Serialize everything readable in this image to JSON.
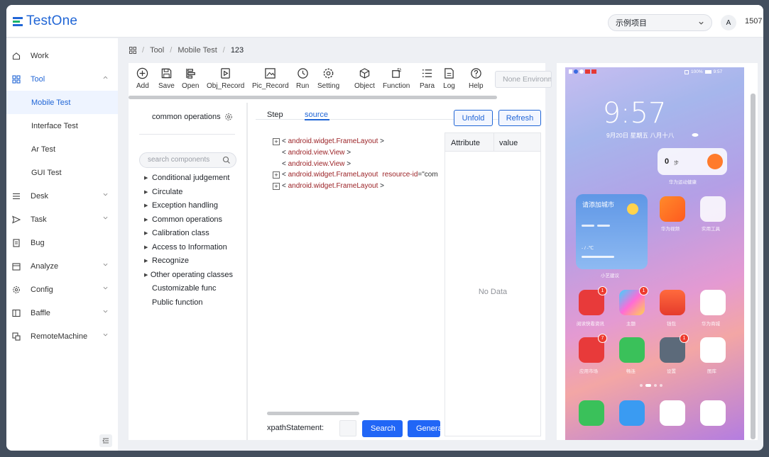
{
  "app": {
    "title": "TestOne"
  },
  "header": {
    "project": "示例项目",
    "translate_glyph": "A",
    "user": "1507"
  },
  "sidebar": {
    "items": [
      {
        "label": "Work",
        "icon": "home-icon"
      },
      {
        "label": "Tool",
        "icon": "grid-icon"
      },
      {
        "label": "Desk",
        "icon": "list-icon"
      },
      {
        "label": "Task",
        "icon": "send-icon"
      },
      {
        "label": "Bug",
        "icon": "document-icon"
      },
      {
        "label": "Analyze",
        "icon": "calendar-icon"
      },
      {
        "label": "Config",
        "icon": "gear-icon"
      },
      {
        "label": "Baffle",
        "icon": "panel-icon"
      },
      {
        "label": "RemoteMachine",
        "icon": "remote-icon"
      }
    ],
    "tool_subitems": [
      "Mobile Test",
      "Interface Test",
      "Ar Test",
      "GUI Test"
    ]
  },
  "breadcrumb": [
    "Tool",
    "Mobile Test",
    "123"
  ],
  "toolbar": {
    "buttons": [
      "Add",
      "Save",
      "Open",
      "Obj_Record",
      "Pic_Record",
      "Run",
      "Setting",
      "Object",
      "Function",
      "Para",
      "Log",
      "Help"
    ],
    "env_placeholder": "None Environment"
  },
  "components": {
    "header": "common operations",
    "search_placeholder": "search components",
    "groups": [
      "Conditional judgement",
      "Circulate",
      "Exception handling",
      "Common operations",
      "Calibration class",
      "Access to Information",
      "Recognize",
      "Other operating classes"
    ],
    "leaves": [
      "Customizable func",
      "Public function"
    ]
  },
  "source": {
    "tabs": [
      "Step",
      "source"
    ],
    "unfold": "Unfold",
    "refresh": "Refresh",
    "tree": [
      {
        "text": "android.widget.FrameLayout",
        "expandable": true
      },
      {
        "text": "android.view.View",
        "expandable": false
      },
      {
        "text": "android.view.View",
        "expandable": false
      },
      {
        "text": "android.widget.FrameLayout",
        "expandable": true,
        "attr": "resource-id",
        "attr_value": "=\"com"
      },
      {
        "text": "android.widget.FrameLayout",
        "expandable": true
      }
    ],
    "open_bracket": "<",
    "close_bracket": ">",
    "attr_header": "Attribute",
    "value_header": "value",
    "no_data": "No Data",
    "xpath_label": "xpathStatement:",
    "search_btn": "Search",
    "generate_btn": "Generate"
  },
  "phone": {
    "time": "9:57",
    "status_time": "9:57",
    "battery": "100%",
    "date": "9月20日 星期五 八月十八",
    "steps": "0",
    "steps_unit": "步",
    "health_label": "华为运动健康",
    "weather_title": "请添加城市",
    "weather_temp": "- / -℃",
    "weather_label": "小艺建议",
    "apps_row1": [
      {
        "label": "华为视频"
      },
      {
        "label": "实用工具"
      }
    ],
    "apps_row2": [
      {
        "label": "阅读快看资讯",
        "badge": "1"
      },
      {
        "label": "主题",
        "badge": "1"
      },
      {
        "label": "钱包",
        "badge": ""
      },
      {
        "label": "华为商城",
        "badge": ""
      }
    ],
    "apps_row3": [
      {
        "label": "应用市场",
        "badge": "7"
      },
      {
        "label": "畅连",
        "badge": ""
      },
      {
        "label": "设置",
        "badge": "1"
      },
      {
        "label": "图库",
        "badge": ""
      }
    ],
    "colors": {
      "accent": "#2166d6",
      "primary_btn": "#2166f6",
      "tag": "#9b2226"
    }
  }
}
